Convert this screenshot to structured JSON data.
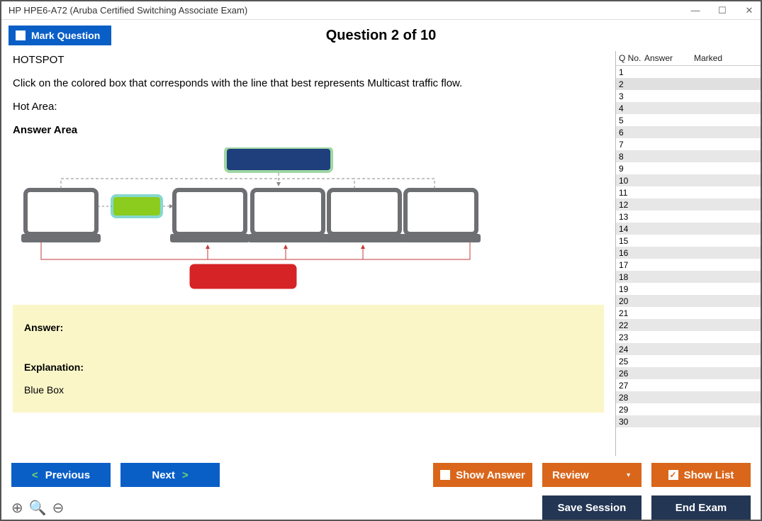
{
  "window": {
    "title": "HP HPE6-A72 (Aruba Certified Switching Associate Exam)"
  },
  "topbar": {
    "mark_label": "Mark Question",
    "question_title": "Question 2 of 10"
  },
  "question": {
    "type": "HOTSPOT",
    "prompt": "Click on the colored box that corresponds with the line that best represents Multicast traffic flow.",
    "hot_area_label": "Hot Area:",
    "answer_area_label": "Answer Area"
  },
  "answerbox": {
    "answer_label": "Answer:",
    "explanation_label": "Explanation:",
    "explanation_text": "Blue Box"
  },
  "side": {
    "headers": {
      "qno": "Q No.",
      "answer": "Answer",
      "marked": "Marked"
    },
    "count": 30,
    "selected": 2
  },
  "footer": {
    "previous": "Previous",
    "next": "Next",
    "show_answer": "Show Answer",
    "review": "Review",
    "show_list": "Show List",
    "save_session": "Save Session",
    "end_exam": "End Exam"
  }
}
